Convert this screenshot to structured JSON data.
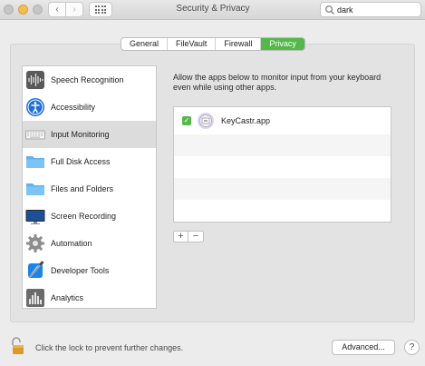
{
  "window": {
    "title": "Security & Privacy"
  },
  "toolbar": {
    "back_glyph": "‹",
    "forward_glyph": "›",
    "search": {
      "value": "dark",
      "placeholder": "Search"
    }
  },
  "tabs": [
    {
      "label": "General",
      "active": false
    },
    {
      "label": "FileVault",
      "active": false
    },
    {
      "label": "Firewall",
      "active": false
    },
    {
      "label": "Privacy",
      "active": true
    }
  ],
  "sidebar": {
    "items": [
      {
        "label": "Speech Recognition",
        "icon": "waveform-icon"
      },
      {
        "label": "Accessibility",
        "icon": "accessibility-icon"
      },
      {
        "label": "Input Monitoring",
        "icon": "keyboard-icon",
        "selected": true
      },
      {
        "label": "Full Disk Access",
        "icon": "folder-icon"
      },
      {
        "label": "Files and Folders",
        "icon": "folder-icon"
      },
      {
        "label": "Screen Recording",
        "icon": "display-icon"
      },
      {
        "label": "Automation",
        "icon": "gear-icon"
      },
      {
        "label": "Developer Tools",
        "icon": "xcode-icon"
      },
      {
        "label": "Analytics",
        "icon": "bar-chart-icon"
      }
    ]
  },
  "main": {
    "description": "Allow the apps below to monitor input from your keyboard even while using other apps.",
    "apps": [
      {
        "name": "KeyCastr.app",
        "checked": true
      }
    ],
    "add_label": "+",
    "remove_label": "−"
  },
  "footer": {
    "lock_text": "Click the lock to prevent further changes.",
    "advanced_label": "Advanced...",
    "help_label": "?"
  },
  "colors": {
    "accent": "#54b94a",
    "folder": "#5fb3f0",
    "minimize": "#f5bd4f"
  }
}
